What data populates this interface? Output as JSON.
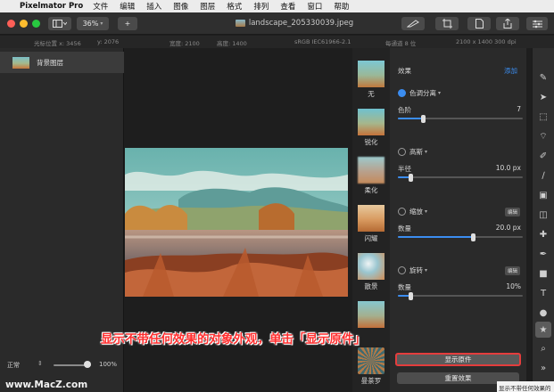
{
  "menubar": {
    "app_name": "Pixelmator Pro",
    "items": [
      "文件",
      "编辑",
      "插入",
      "图像",
      "图层",
      "格式",
      "排列",
      "查看",
      "窗口",
      "帮助"
    ]
  },
  "toolbar": {
    "zoom": "36%",
    "add_label": "+",
    "document_title": "landscape_205330039.jpeg"
  },
  "infobar": {
    "cursor_x": "光标位置 x: 3456",
    "cursor_y": "y: 2076",
    "width": "宽度: 2100",
    "height": "高度: 1400",
    "color_profile": "sRGB IEC61966-2.1",
    "bit_depth": "每通道 8 位",
    "dimensions": "2100 x 1400 300 dpi"
  },
  "layers": {
    "items": [
      {
        "label": "背景图层"
      }
    ],
    "blend_mode": "正常",
    "zoom_percent": "100%",
    "zoom_level": 0.9
  },
  "effect_thumbs": [
    {
      "label": "无"
    },
    {
      "label": "锐化"
    },
    {
      "label": "柔化"
    },
    {
      "label": "闪耀"
    },
    {
      "label": "散景"
    },
    {
      "label": ""
    },
    {
      "label": "曼荼罗"
    }
  ],
  "effects_panel": {
    "header": "效果",
    "add_label": "添加",
    "edit_label": "编辑",
    "groups": [
      {
        "name": "色调分离",
        "enabled": true,
        "param": "色阶",
        "value": "7",
        "level": 0.2
      },
      {
        "name": "高斯",
        "enabled": false,
        "param": "半径",
        "value": "10.0 px",
        "level": 0.1
      },
      {
        "name": "缩放",
        "enabled": false,
        "param": "数量",
        "value": "20.0 px",
        "level": 0.6
      },
      {
        "name": "旋转",
        "enabled": false,
        "param": "数量",
        "value": "10%",
        "level": 0.1
      }
    ],
    "show_original_label": "显示原件",
    "reset_label": "重置效果"
  },
  "annotation": "显示不带任何效果的对象外观，单击「显示原件」",
  "watermark": "www.MacZ.com",
  "tooltip": "显示不带任何效果的",
  "colors": {
    "accent": "#3b8df0",
    "highlight": "#e43d3d"
  }
}
